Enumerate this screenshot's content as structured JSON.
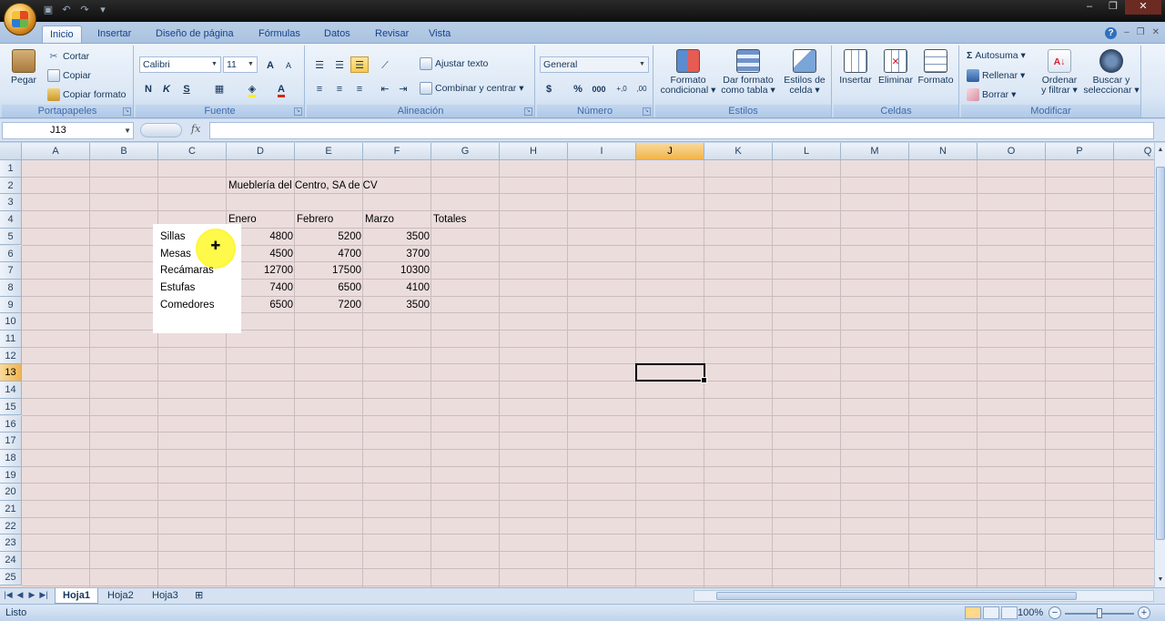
{
  "ribbon_tabs": [
    "Inicio",
    "Insertar",
    "Diseño de página",
    "Fórmulas",
    "Datos",
    "Revisar",
    "Vista"
  ],
  "clipboard": {
    "paste": "Pegar",
    "cut": "Cortar",
    "copy": "Copiar",
    "format_painter": "Copiar formato",
    "label": "Portapapeles"
  },
  "font": {
    "name": "Calibri",
    "size": "11",
    "bold": "N",
    "italic": "K",
    "underline": "S",
    "grow": "A",
    "shrink": "A",
    "color_letter": "A",
    "label": "Fuente"
  },
  "alignment": {
    "wrap": "Ajustar texto",
    "merge": "Combinar y centrar",
    "label": "Alineación"
  },
  "number": {
    "format": "General",
    "currency": "$",
    "percent": "%",
    "thousands": "000",
    "inc_dec": "+,0",
    "dec_dec": ",00",
    "label": "Número"
  },
  "styles": {
    "conditional": [
      "Formato",
      "condicional"
    ],
    "as_table": [
      "Dar formato",
      "como tabla"
    ],
    "cell_styles": [
      "Estilos de",
      "celda"
    ],
    "label": "Estilos"
  },
  "cells": {
    "insert": "Insertar",
    "delete": "Eliminar",
    "format": "Formato",
    "label": "Celdas"
  },
  "editing": {
    "autosum": "Autosuma",
    "fill": "Rellenar",
    "clear": "Borrar",
    "sort": [
      "Ordenar",
      "y filtrar"
    ],
    "find": [
      "Buscar y",
      "seleccionar"
    ],
    "label": "Modificar"
  },
  "formula_bar": {
    "name_box": "J13",
    "fx": "fx",
    "content": ""
  },
  "columns": [
    "A",
    "B",
    "C",
    "D",
    "E",
    "F",
    "G",
    "H",
    "I",
    "J",
    "K",
    "L",
    "M",
    "N",
    "O",
    "P",
    "Q"
  ],
  "selected_column": "J",
  "rows": [
    "1",
    "2",
    "3",
    "4",
    "5",
    "6",
    "7",
    "8",
    "9",
    "10",
    "11",
    "12",
    "13",
    "14",
    "15",
    "16",
    "17",
    "18",
    "19",
    "20",
    "21",
    "22",
    "23",
    "24",
    "25"
  ],
  "selected_row": "13",
  "sheet": {
    "title": "Mueblería del Centro, SA de CV",
    "headers": [
      "Enero",
      "Febrero",
      "Marzo",
      "Totales"
    ],
    "items": [
      {
        "name": "Sillas",
        "values": [
          "4800",
          "5200",
          "3500"
        ]
      },
      {
        "name": "Mesas",
        "values": [
          "4500",
          "4700",
          "3700"
        ]
      },
      {
        "name": "Recámaras",
        "values": [
          "12700",
          "17500",
          "10300"
        ]
      },
      {
        "name": "Estufas",
        "values": [
          "7400",
          "6500",
          "4100"
        ]
      },
      {
        "name": "Comedores",
        "values": [
          "6500",
          "7200",
          "3500"
        ]
      }
    ]
  },
  "sheet_tabs": [
    "Hoja1",
    "Hoja2",
    "Hoja3"
  ],
  "active_sheet": "Hoja1",
  "status": {
    "text": "Listo",
    "zoom": "100%"
  },
  "colors": {
    "accent": "#15428b",
    "ribbon": "#dbe7f5",
    "selected_header": "#f1b44c",
    "highlight": "#fff94a"
  }
}
